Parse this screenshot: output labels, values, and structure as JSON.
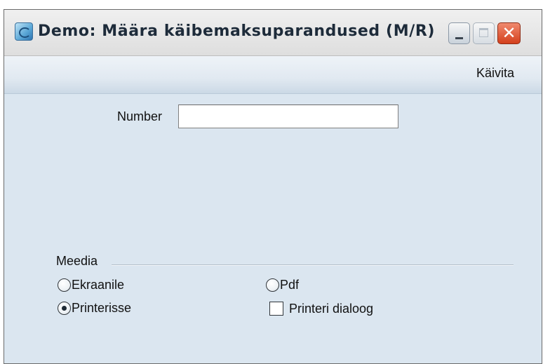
{
  "window": {
    "title": "Demo: Määra käibemaksuparandused (M/R)",
    "icon": "app-icon",
    "controls": {
      "minimize": "minimize-icon",
      "maximize": "maximize-icon",
      "close": "✕"
    }
  },
  "toolbar": {
    "run_label": "Käivita"
  },
  "form": {
    "number_label": "Number",
    "number_value": ""
  },
  "media": {
    "title": "Meedia",
    "options": [
      {
        "label": "Ekraanile",
        "type": "radio",
        "checked": false
      },
      {
        "label": "Pdf",
        "type": "radio",
        "checked": false
      },
      {
        "label": "Printerisse",
        "type": "radio",
        "checked": true
      },
      {
        "label": "Printeri dialoog",
        "type": "checkbox",
        "checked": false
      }
    ]
  },
  "colors": {
    "window_background": "#dbe6f0",
    "close_button": "#d43f1c"
  }
}
